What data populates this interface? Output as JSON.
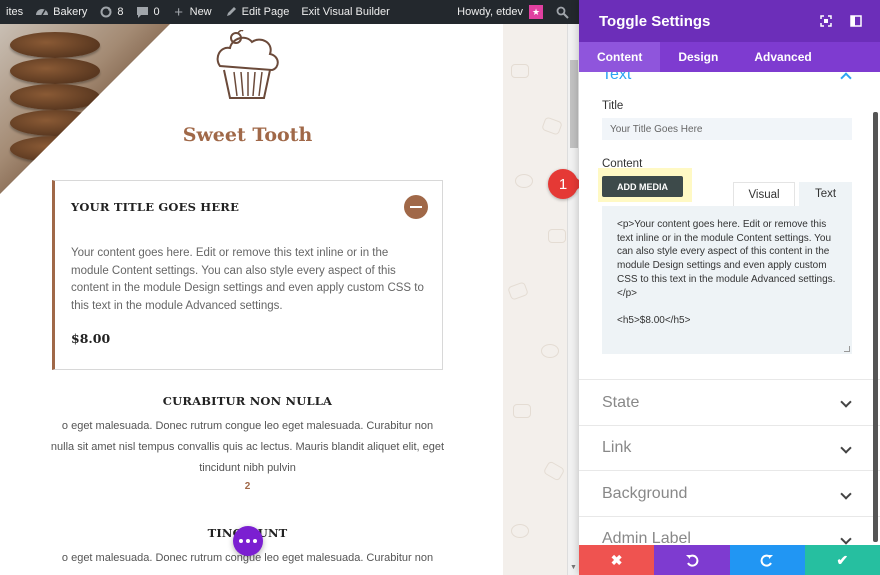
{
  "admin_bar": {
    "sites": "ites",
    "site_name": "Bakery",
    "updates_count": "8",
    "comments_count": "0",
    "new": "New",
    "edit_page": "Edit Page",
    "exit_builder": "Exit Visual Builder",
    "howdy": "Howdy, etdev"
  },
  "page": {
    "brand": "Sweet Tooth",
    "toggle": {
      "title": "YOUR TITLE GOES HERE",
      "content": "Your content goes here. Edit or remove this text inline or in the module Content settings. You can also style every aspect of this content in the module Design settings and even apply custom CSS to this text in the module Advanced settings.",
      "price": "$8.00"
    },
    "item1": {
      "title": "CURABITUR NON NULLA",
      "text": "o eget malesuada. Donec rutrum congue leo eget malesuada. Curabitur non nulla sit amet nisl tempus convallis quis ac lectus. Mauris blandit aliquet elit, eget tincidunt nibh pulvin",
      "number": "2"
    },
    "item2": {
      "title": "TINCIDUNT",
      "text": "o eget malesuada. Donec rutrum congue leo eget malesuada. Curabitur non"
    }
  },
  "panel": {
    "title": "Toggle Settings",
    "tabs": [
      "Content",
      "Design",
      "Advanced"
    ],
    "active_tab": "Content",
    "sections": {
      "text": "Text",
      "state": "State",
      "link": "Link",
      "background": "Background",
      "admin_label": "Admin Label"
    },
    "fields": {
      "title_label": "Title",
      "title_value": "Your Title Goes Here",
      "content_label": "Content",
      "add_media": "ADD MEDIA",
      "visual_tab": "Visual",
      "text_tab": "Text",
      "code": "<p>Your content goes here. Edit or remove this text inline or in the module Content settings. You can also style every aspect of this content in the module Design settings and even apply custom CSS to this text in the module Advanced settings.</p>\n\n<h5>$8.00</h5>"
    },
    "annotation_badge": "1",
    "footer_colors": [
      "#ef5350",
      "#7e3bd0",
      "#2196f3",
      "#26bfa0"
    ]
  }
}
